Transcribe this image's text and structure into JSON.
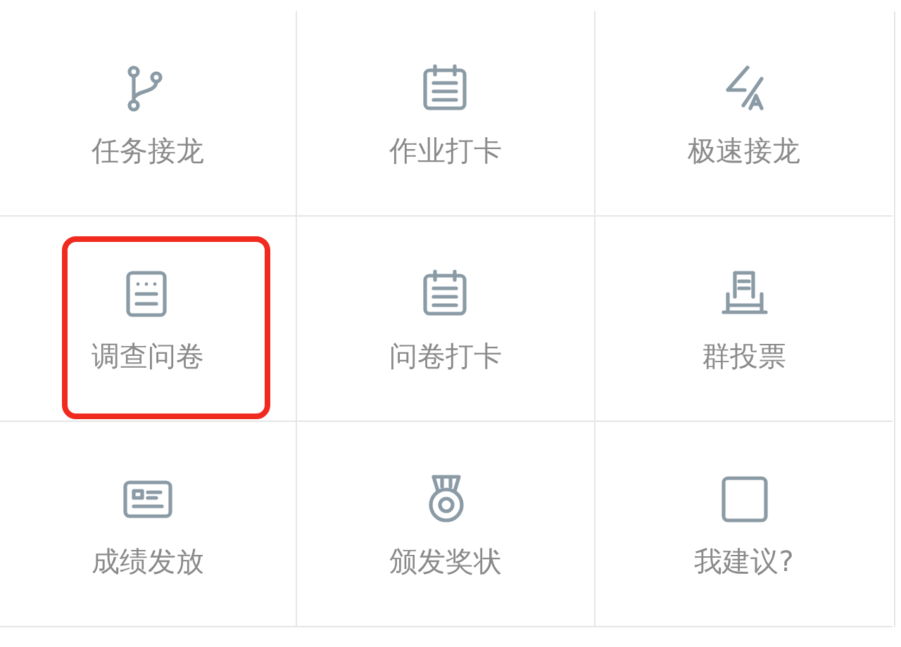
{
  "items": [
    {
      "label": "任务接龙",
      "highlighted": false
    },
    {
      "label": "作业打卡",
      "highlighted": false
    },
    {
      "label": "极速接龙",
      "highlighted": false
    },
    {
      "label": "调查问卷",
      "highlighted": true
    },
    {
      "label": "问卷打卡",
      "highlighted": false
    },
    {
      "label": "群投票",
      "highlighted": false
    },
    {
      "label": "成绩发放",
      "highlighted": false
    },
    {
      "label": "颁发奖状",
      "highlighted": false
    },
    {
      "label": "我建议?",
      "highlighted": false
    }
  ]
}
